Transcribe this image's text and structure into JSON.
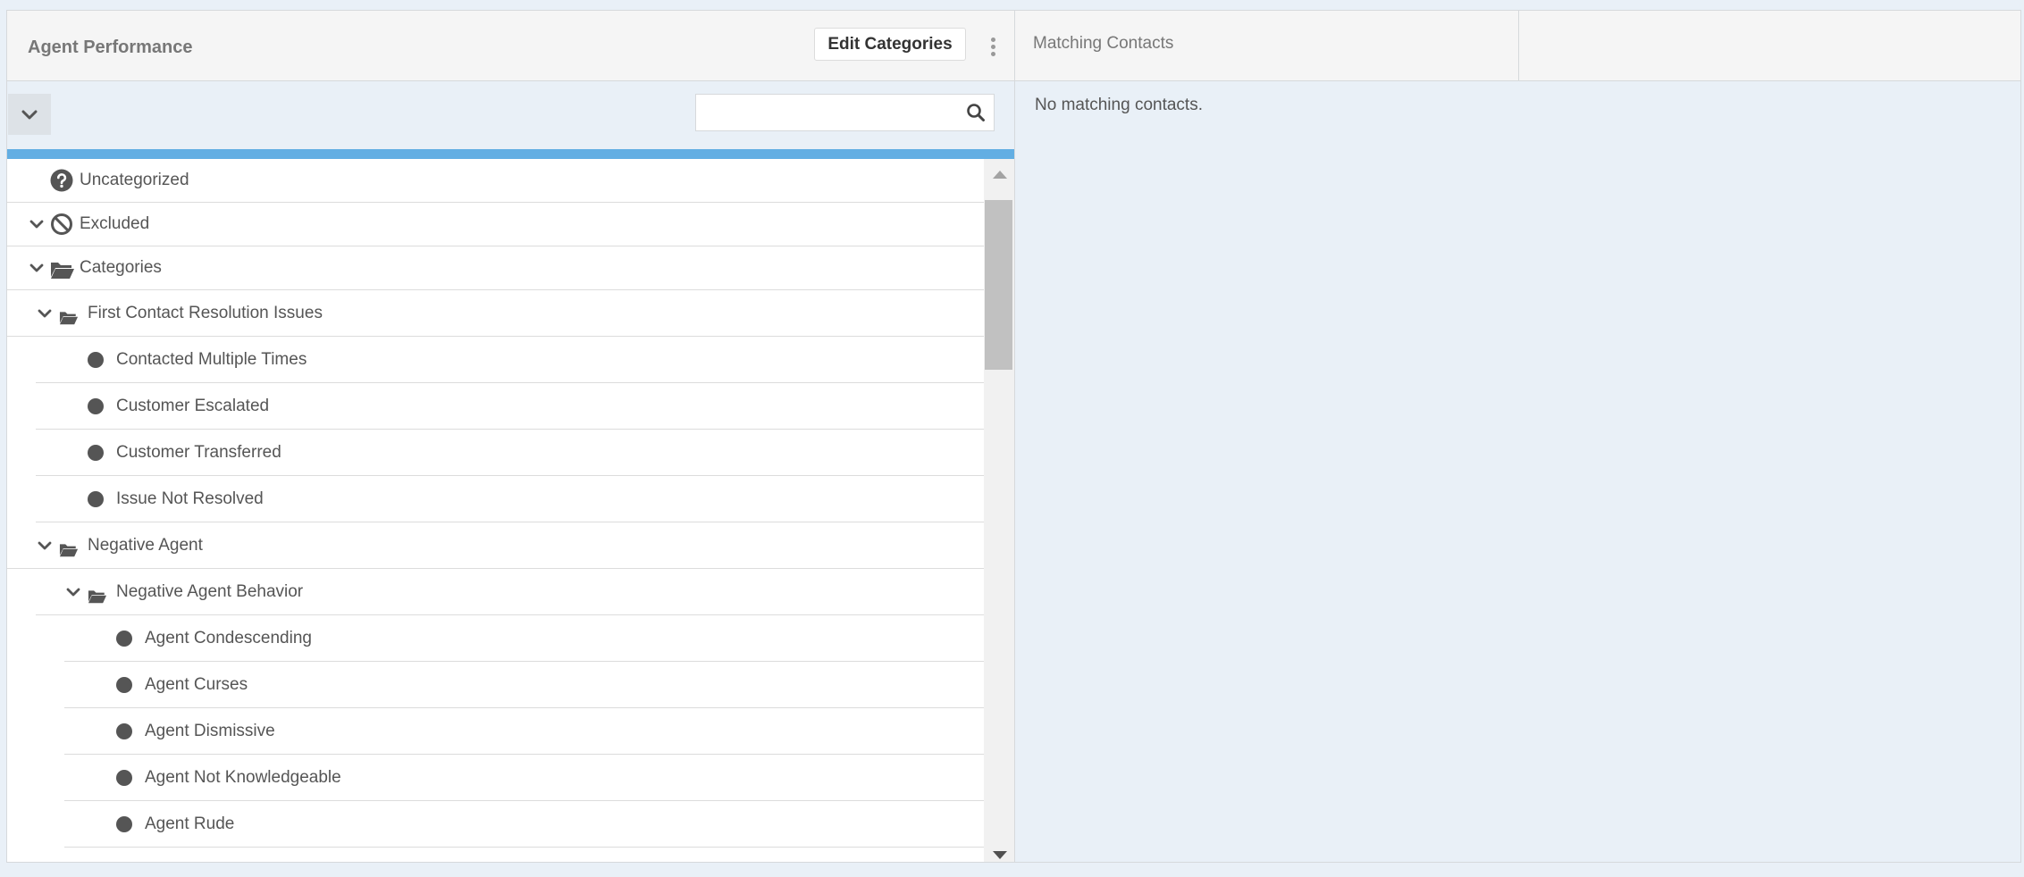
{
  "left_panel": {
    "title": "Agent Performance",
    "edit_button_label": "Edit Categories",
    "search_placeholder": ""
  },
  "tree": [
    {
      "label": "Uncategorized",
      "icon": "question-circle-icon",
      "expandable": false,
      "level": 0
    },
    {
      "label": "Excluded",
      "icon": "ban-icon",
      "expandable": true,
      "level": 0
    },
    {
      "label": "Categories",
      "icon": "folder-open-icon",
      "expandable": true,
      "level": 0
    },
    {
      "label": "First Contact Resolution Issues",
      "icon": "folder-open-icon",
      "expandable": true,
      "level": 1
    },
    {
      "label": "Contacted Multiple Times",
      "icon": "category-dot-icon",
      "expandable": false,
      "level": 2
    },
    {
      "label": "Customer Escalated",
      "icon": "category-dot-icon",
      "expandable": false,
      "level": 2
    },
    {
      "label": "Customer Transferred",
      "icon": "category-dot-icon",
      "expandable": false,
      "level": 2
    },
    {
      "label": "Issue Not Resolved",
      "icon": "category-dot-icon",
      "expandable": false,
      "level": 2
    },
    {
      "label": "Negative Agent",
      "icon": "folder-open-icon",
      "expandable": true,
      "level": 1
    },
    {
      "label": "Negative Agent Behavior",
      "icon": "folder-open-icon",
      "expandable": true,
      "level": 2
    },
    {
      "label": "Agent Condescending",
      "icon": "category-dot-icon",
      "expandable": false,
      "level": 3
    },
    {
      "label": "Agent Curses",
      "icon": "category-dot-icon",
      "expandable": false,
      "level": 3
    },
    {
      "label": "Agent Dismissive",
      "icon": "category-dot-icon",
      "expandable": false,
      "level": 3
    },
    {
      "label": "Agent Not Knowledgeable",
      "icon": "category-dot-icon",
      "expandable": false,
      "level": 3
    },
    {
      "label": "Agent Rude",
      "icon": "category-dot-icon",
      "expandable": false,
      "level": 3
    }
  ],
  "right_panel": {
    "title": "Matching Contacts",
    "empty_message": "No matching contacts."
  },
  "colors": {
    "accent_bar": "#62aee3",
    "background": "#e9f0f7",
    "header_bg": "#f5f5f5",
    "icon": "#555555"
  }
}
